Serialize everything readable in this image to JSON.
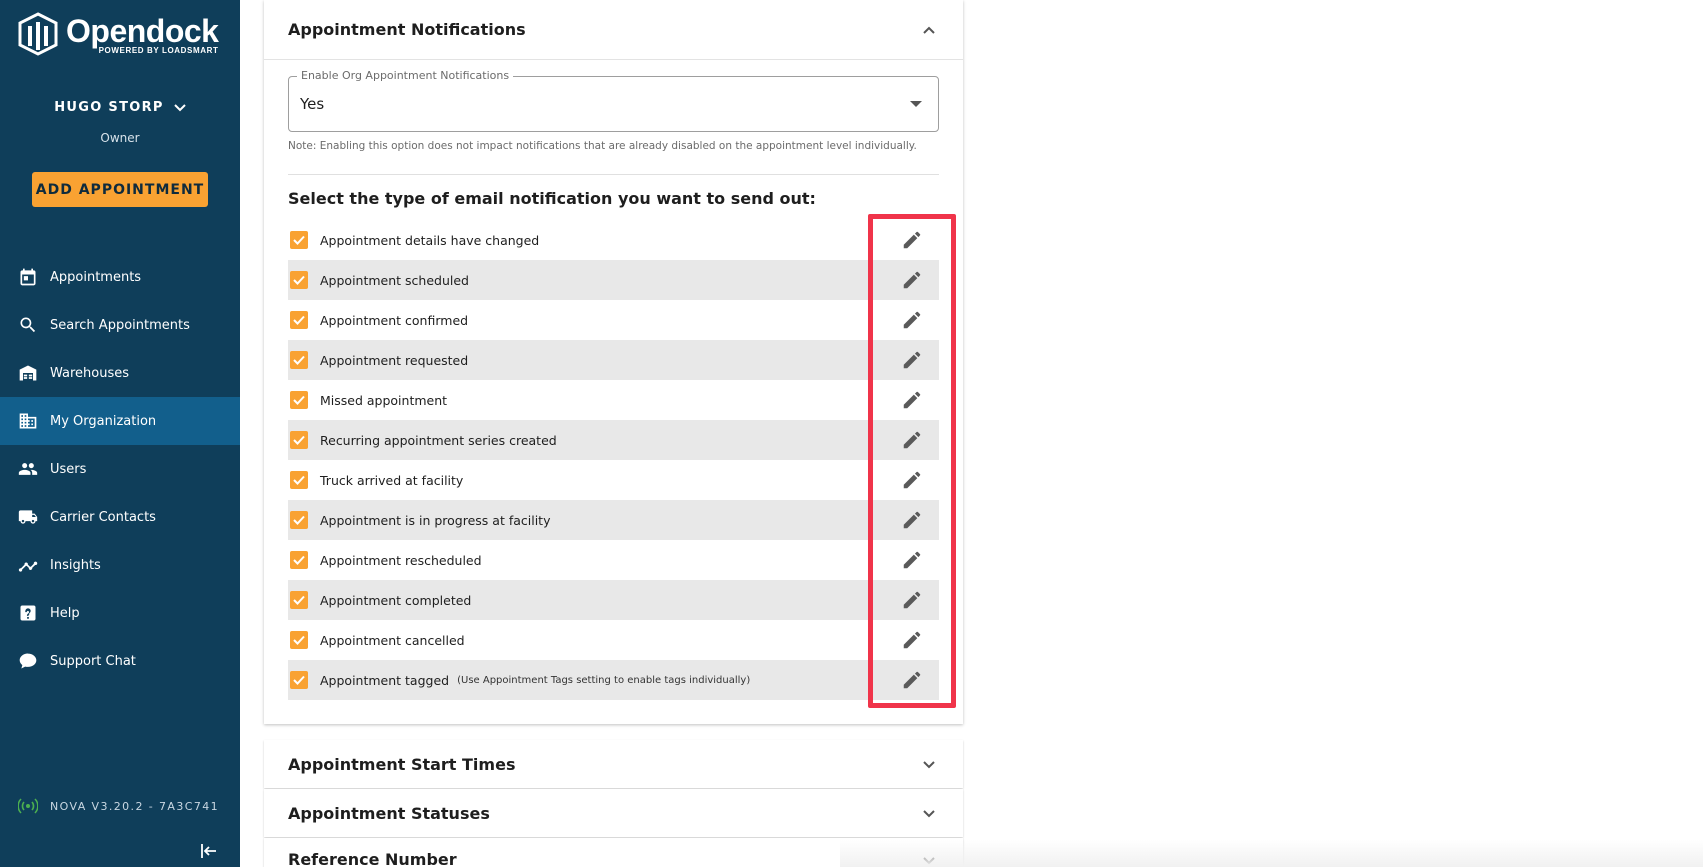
{
  "brand": {
    "name": "Opendock",
    "tagline": "POWERED BY LOADSMART"
  },
  "user": {
    "name": "HUGO STORP",
    "role": "Owner"
  },
  "add_button": "ADD APPOINTMENT",
  "nav": [
    {
      "label": "Appointments",
      "icon": "calendar-icon"
    },
    {
      "label": "Search Appointments",
      "icon": "search-icon"
    },
    {
      "label": "Warehouses",
      "icon": "warehouse-icon"
    },
    {
      "label": "My Organization",
      "icon": "building-icon",
      "active": true
    },
    {
      "label": "Users",
      "icon": "users-icon"
    },
    {
      "label": "Carrier Contacts",
      "icon": "truck-icon"
    },
    {
      "label": "Insights",
      "icon": "insights-icon"
    },
    {
      "label": "Help",
      "icon": "help-icon"
    },
    {
      "label": "Support Chat",
      "icon": "chat-icon"
    }
  ],
  "version": "NOVA V3.20.2 - 7A3C741",
  "panel": {
    "title": "Appointment Notifications",
    "select": {
      "legend": "Enable Org Appointment Notifications",
      "value": "Yes"
    },
    "note": "Note: Enabling this option does not impact notifications that are already disabled on the appointment level individually.",
    "heading": "Select the type of email notification you want to send out:",
    "rows": [
      {
        "label": "Appointment details have changed",
        "checked": true
      },
      {
        "label": "Appointment scheduled",
        "checked": true
      },
      {
        "label": "Appointment confirmed",
        "checked": true
      },
      {
        "label": "Appointment requested",
        "checked": true
      },
      {
        "label": "Missed appointment",
        "checked": true
      },
      {
        "label": "Recurring appointment series created",
        "checked": true
      },
      {
        "label": "Truck arrived at facility",
        "checked": true
      },
      {
        "label": "Appointment is in progress at facility",
        "checked": true
      },
      {
        "label": "Appointment rescheduled",
        "checked": true
      },
      {
        "label": "Appointment completed",
        "checked": true
      },
      {
        "label": "Appointment cancelled",
        "checked": true
      },
      {
        "label": "Appointment tagged",
        "hint": "(Use Appointment Tags setting to enable tags individually)",
        "checked": true
      }
    ]
  },
  "accordions": [
    {
      "title": "Appointment Start Times"
    },
    {
      "title": "Appointment Statuses"
    },
    {
      "title": "Reference Number"
    }
  ],
  "colors": {
    "sidebar": "#0f3e5a",
    "active_nav": "#125f8c",
    "accent": "#f9a232",
    "highlight": "#f0344a"
  }
}
